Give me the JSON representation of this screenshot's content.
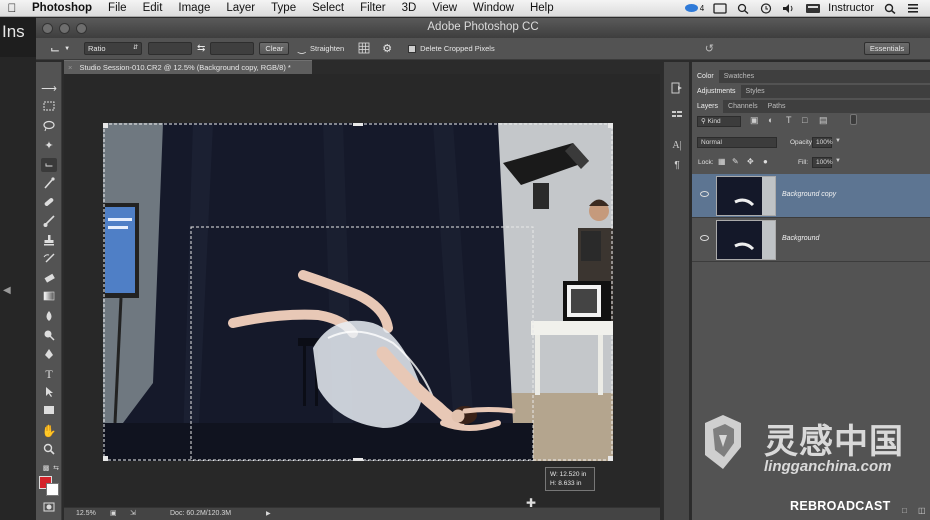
{
  "menubar": {
    "app": "Photoshop",
    "items": [
      "File",
      "Edit",
      "Image",
      "Layer",
      "Type",
      "Select",
      "Filter",
      "3D",
      "View",
      "Window",
      "Help"
    ],
    "badge": "4",
    "user": "Instructor"
  },
  "window": {
    "title": "Adobe Photoshop CC"
  },
  "behind": {
    "partial_title": "Ins"
  },
  "options": {
    "ratio": "Ratio",
    "clear": "Clear",
    "straighten": "Straighten",
    "delete_cropped": "Delete Cropped Pixels",
    "delete_cropped_checked": true,
    "workspace": "Essentials"
  },
  "document": {
    "tab": "Studio Session-010.CR2 @ 12.5% (Background copy, RGB/8) *",
    "zoom": "12.5%",
    "docsize": "Doc: 60.2M/120.3M",
    "crop_width": "W: 12.520 in",
    "crop_height": "H:  8.633 in"
  },
  "panels": {
    "top_tabs": [
      "Color",
      "Swatches"
    ],
    "mid_tabs": [
      "Adjustments",
      "Styles"
    ],
    "layer_tabs": [
      "Layers",
      "Channels",
      "Paths"
    ],
    "kind": "Kind",
    "blend_mode": "Normal",
    "opacity_label": "Opacity:",
    "opacity": "100%",
    "lock_label": "Lock:",
    "fill_label": "Fill:",
    "fill": "100%",
    "layers": [
      {
        "name": "Background copy",
        "selected": true
      },
      {
        "name": "Background",
        "selected": false
      }
    ]
  },
  "watermark": {
    "cn": "灵感中国",
    "url": "lingganchina.com",
    "broadcast": "REBROADCAST"
  },
  "colors": {
    "foreground": "#d4232a",
    "background": "#ffffff",
    "selected_layer": "#5d7592"
  }
}
